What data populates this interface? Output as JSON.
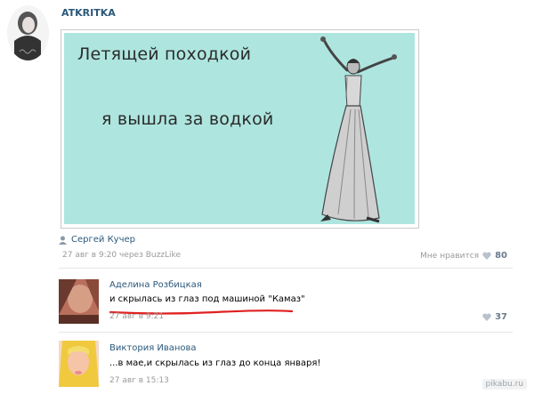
{
  "group": {
    "name": "ATKRITKA",
    "avatar_label": "atkritka"
  },
  "postcard": {
    "line1": "Летящей походкой",
    "line2": "я вышла за водкой"
  },
  "post": {
    "author": "Сергей Кучер",
    "date": "27 авг в 9:20 через BuzzLike",
    "like_label": "Мне нравится",
    "like_count": "80"
  },
  "comments": [
    {
      "name": "Аделина Розбицкая",
      "text": "и скрылась из глаз под машиной \"Камаз\"",
      "date": "27 авг в 9:21",
      "likes": "37"
    },
    {
      "name": "Виктория Иванова",
      "text": "...в мае,и скрылась из глаз до конца января!",
      "date": "27 авг в 15:13"
    }
  ],
  "watermark": "pikabu.ru",
  "colors": {
    "link": "#2b587a",
    "postcard_bg": "#aee5df",
    "underline": "#e02020",
    "meta": "#9a9a9a"
  },
  "icons": [
    "person-icon",
    "heart-icon"
  ]
}
